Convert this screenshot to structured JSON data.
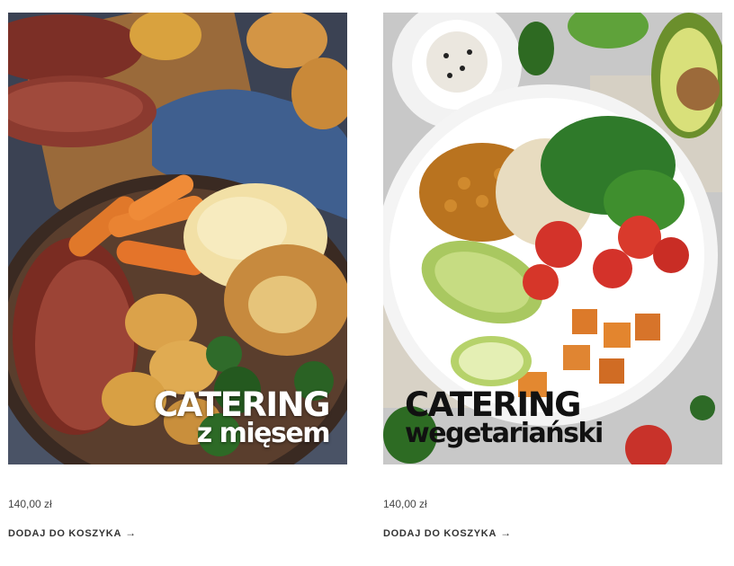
{
  "products": [
    {
      "image_line1": "CATERING",
      "image_line2": "z mięsem",
      "price": "140,00 zł",
      "add_to_cart": "DODAJ DO KOSZYKA",
      "arrow": "→"
    },
    {
      "image_line1": "CATERING",
      "image_line2": "wegetariański",
      "price": "140,00 zł",
      "add_to_cart": "DODAJ DO KOSZYKA",
      "arrow": "→"
    }
  ],
  "colors": {
    "text_dark": "#333333",
    "price_text": "#444444",
    "overlay_light": "#ffffff",
    "overlay_dark": "#111111"
  }
}
